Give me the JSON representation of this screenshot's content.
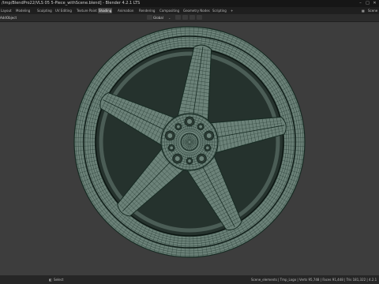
{
  "window": {
    "title": "/tmp/BlendPro22/VLS 05 5-Piece_withScene.blend] - Blender 4.2.1 LTS",
    "minimize": "–",
    "maximize": "□",
    "close": "✕"
  },
  "workspaces": [
    {
      "label": "Layout"
    },
    {
      "label": "Modeling"
    },
    {
      "label": "Sculpting"
    },
    {
      "label": "UV Editing"
    },
    {
      "label": "Texture Paint"
    },
    {
      "label": "Shading"
    },
    {
      "label": "Animation"
    },
    {
      "label": "Rendering"
    },
    {
      "label": "Compositing"
    },
    {
      "label": "Geometry Nodes"
    },
    {
      "label": "Scripting"
    },
    {
      "label": "+"
    }
  ],
  "active_workspace": "Shading",
  "scene_label": "Scene",
  "header": {
    "menu_add": "Add",
    "menu_object": "Object",
    "orientation": "Global"
  },
  "status": {
    "left": "Select",
    "right": "Scene_elements | Tmp_Logo | Verts 95,748 | Faces 91,448 | Tris 181,322 | 4.2.1"
  },
  "colors": {
    "mesh_fill": "#6c8279",
    "mesh_wire": "#162a22",
    "background": "#3d3d3d"
  }
}
